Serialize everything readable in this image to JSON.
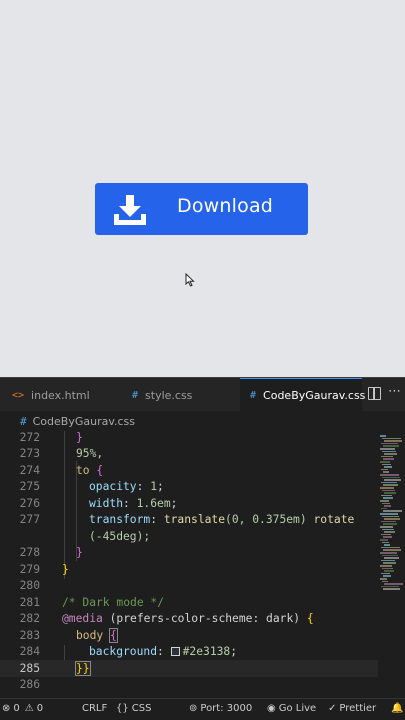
{
  "preview": {
    "download_button_label": "Download"
  },
  "editor": {
    "tabs": [
      {
        "label": "index.html",
        "icon": "<>",
        "active": false
      },
      {
        "label": "style.css",
        "icon": "#",
        "active": false
      },
      {
        "label": "CodeByGaurav.css",
        "icon": "#",
        "active": true
      }
    ],
    "breadcrumb": {
      "icon": "#",
      "file": "CodeByGaurav.css"
    },
    "lines": [
      {
        "n": "272"
      },
      {
        "n": "273"
      },
      {
        "n": "274"
      },
      {
        "n": "275"
      },
      {
        "n": "276"
      },
      {
        "n": "277"
      },
      {
        "n": ""
      },
      {
        "n": "278"
      },
      {
        "n": "279"
      },
      {
        "n": "280"
      },
      {
        "n": "281"
      },
      {
        "n": "282"
      },
      {
        "n": "283"
      },
      {
        "n": "284"
      },
      {
        "n": "285"
      },
      {
        "n": "286"
      }
    ],
    "code": {
      "l272": "}",
      "l273": "95%,",
      "l274_kw": "to",
      "l274_br": "{",
      "l275_prop": "opacity",
      "l275_val": "1",
      "l276_prop": "width",
      "l276_val": "1.6em",
      "l277_prop": "transform",
      "l277_fn": "translate",
      "l277_args": "(0, 0.375em)",
      "l277_fn2": "rotate",
      "l277b": "(-45deg);",
      "l278": "}",
      "l279": "}",
      "l281": "/* Dark mode */",
      "l282_kw": "@media",
      "l282_q": "(prefers-color-scheme: dark)",
      "l282_br": "{",
      "l283_sel": "body",
      "l283_br": "{",
      "l284_prop": "background",
      "l284_val": "#2e3138",
      "l285": "}}"
    },
    "swatch_color": "#2e3138"
  },
  "statusbar": {
    "errors": "0",
    "warnings": "0",
    "eol": "CRLF",
    "language": "CSS",
    "port": "Port: 3000",
    "go_live": "Go Live",
    "prettier": "Prettier"
  },
  "colors": {
    "preview_bg": "#e4e5e9",
    "button_bg": "#2563eb",
    "editor_bg": "#1e1e1e",
    "tab_accent": "#3794ff"
  }
}
